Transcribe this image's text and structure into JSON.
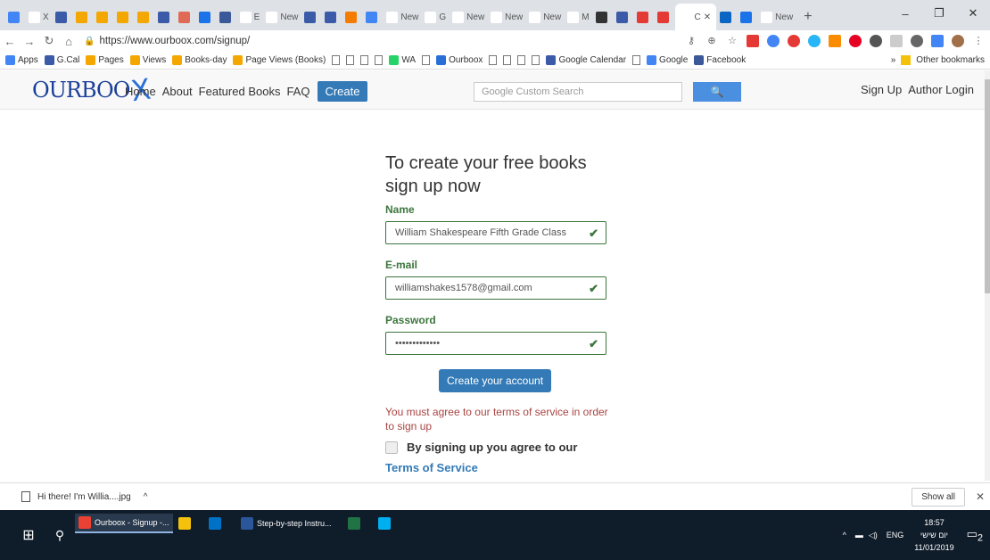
{
  "browser": {
    "tabs": [
      {
        "label": "",
        "color": "#4285f4"
      },
      {
        "label": "X",
        "color": "#ffffff"
      },
      {
        "label": "",
        "color": "#3b5aa8"
      },
      {
        "label": "",
        "color": "#f4a700"
      },
      {
        "label": "",
        "color": "#f4a700"
      },
      {
        "label": "",
        "color": "#f4a700"
      },
      {
        "label": "",
        "color": "#f4a700"
      },
      {
        "label": "",
        "color": "#3b5aa8"
      },
      {
        "label": "",
        "color": "#e06a55"
      },
      {
        "label": "",
        "color": "#1a73e8"
      },
      {
        "label": "",
        "color": "#3b5998"
      },
      {
        "label": "E",
        "color": "#ffffff"
      },
      {
        "label": "New",
        "color": "#ffffff"
      },
      {
        "label": "",
        "color": "#3b5aa8"
      },
      {
        "label": "",
        "color": "#3b5aa8"
      },
      {
        "label": "",
        "color": "#f57c00"
      },
      {
        "label": "",
        "color": "#4285f4"
      },
      {
        "label": "New",
        "color": "#ffffff"
      },
      {
        "label": "G",
        "color": "#ffffff"
      },
      {
        "label": "New",
        "color": "#ffffff"
      },
      {
        "label": "New",
        "color": "#ffffff"
      },
      {
        "label": "New",
        "color": "#ffffff"
      },
      {
        "label": "M",
        "color": "#ffffff"
      },
      {
        "label": "",
        "color": "#333333"
      },
      {
        "label": "",
        "color": "#3b5aa8"
      },
      {
        "label": "",
        "color": "#e53935"
      },
      {
        "label": "",
        "color": "#e53935"
      },
      {
        "label": "C",
        "color": "#ffffff",
        "active": true
      },
      {
        "label": "",
        "color": "#0a66c2"
      },
      {
        "label": "",
        "color": "#1a73e8"
      },
      {
        "label": "New",
        "color": "#ffffff"
      }
    ],
    "new_tab": "+",
    "window_controls": {
      "minimize": "–",
      "maximize": "❐",
      "close": "✕"
    },
    "url": "https://www.ourboox.com/signup/",
    "bookmarks": [
      {
        "label": "Apps",
        "icon": "apps-icon",
        "color": "#4285f4"
      },
      {
        "label": "G.Cal",
        "icon": "calendar-icon",
        "color": "#3b5aa8"
      },
      {
        "label": "Pages",
        "icon": "analytics-icon",
        "color": "#f4a700"
      },
      {
        "label": "Views",
        "icon": "analytics-icon",
        "color": "#f4a700"
      },
      {
        "label": "Books-day",
        "icon": "analytics-icon",
        "color": "#f4a700"
      },
      {
        "label": "Page Views (Books)",
        "icon": "analytics-icon",
        "color": "#f4a700"
      },
      {
        "label": "",
        "icon": "page-icon"
      },
      {
        "label": "",
        "icon": "page-icon"
      },
      {
        "label": "",
        "icon": "page-icon"
      },
      {
        "label": "",
        "icon": "page-icon"
      },
      {
        "label": "WA",
        "icon": "whatsapp-icon",
        "color": "#25d366"
      },
      {
        "label": "",
        "icon": "page-icon"
      },
      {
        "label": "Ourboox",
        "icon": "ourboox-icon",
        "color": "#2a6fd6"
      },
      {
        "label": "",
        "icon": "page-icon"
      },
      {
        "label": "",
        "icon": "page-icon"
      },
      {
        "label": "",
        "icon": "page-icon"
      },
      {
        "label": "",
        "icon": "page-icon"
      },
      {
        "label": "Google Calendar",
        "icon": "calendar-icon",
        "color": "#3b5aa8"
      },
      {
        "label": "",
        "icon": "page-icon"
      },
      {
        "label": "Google",
        "icon": "google-icon",
        "color": "#4285f4"
      },
      {
        "label": "Facebook",
        "icon": "facebook-icon",
        "color": "#3b5998"
      }
    ],
    "bookmarks_overflow": "»",
    "other_bookmarks": "Other bookmarks"
  },
  "site": {
    "logo": "OURBOO",
    "logo_x": "X",
    "nav": [
      "Home",
      "About",
      "Featured Books",
      "FAQ"
    ],
    "create": "Create",
    "search_placeholder": "Google Custom Search",
    "search_button": "🔍",
    "signup": "Sign Up",
    "author_login": "Author Login"
  },
  "form": {
    "heading": "To create your free books sign up now",
    "name_label": "Name",
    "name_value": "William Shakespeare Fifth Grade Class",
    "email_label": "E-mail",
    "email_value": "williamshakes1578@gmail.com",
    "password_label": "Password",
    "password_value": "•••••••••••••",
    "check": "✔",
    "submit": "Create your account",
    "error": "You must agree to our terms of service in order to sign up",
    "agree_text": "By signing up you agree to our",
    "tos": "Terms of Service"
  },
  "downloads": {
    "file": "Hi there! I'm Willia....jpg",
    "caret": "^",
    "show_all": "Show all",
    "close": "✕"
  },
  "taskbar": {
    "apps": [
      {
        "label": "Ourboox - Signup -...",
        "color": "#e94235",
        "active": true
      },
      {
        "label": "",
        "color": "#f4c20d"
      },
      {
        "label": "",
        "color": "#0072c6"
      },
      {
        "label": "Step-by-step Instru...",
        "color": "#2b579a"
      },
      {
        "label": "",
        "color": "#217346"
      },
      {
        "label": "",
        "color": "#00aff0"
      }
    ],
    "lang": "ENG",
    "time": "18:57",
    "day": "יום שישי",
    "date": "11/01/2019",
    "notifications": "2"
  }
}
